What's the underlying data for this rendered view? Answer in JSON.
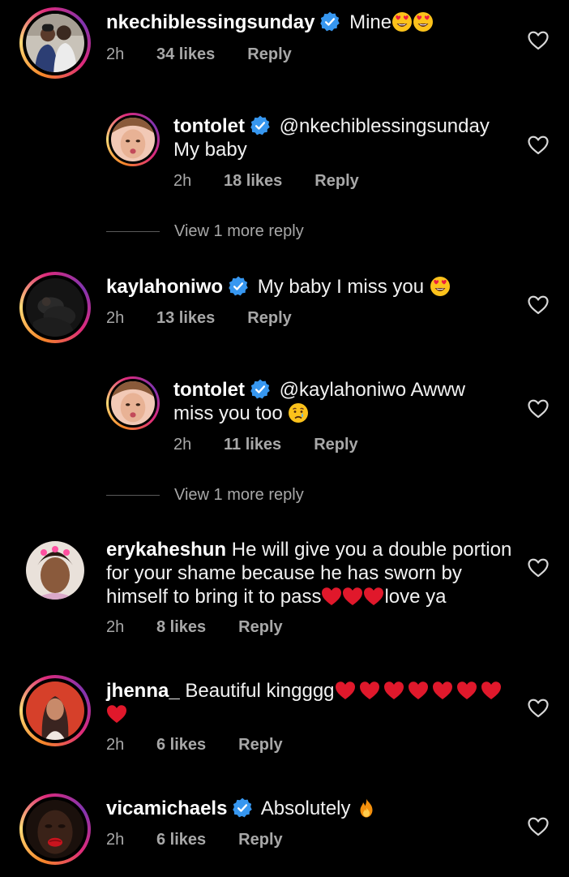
{
  "comments": [
    {
      "username": "nkechiblessingsunday",
      "verified": true,
      "text": "Mine",
      "time": "2h",
      "likes": "34 likes",
      "reply": "Reply"
    },
    {
      "username": "tontolet",
      "verified": true,
      "text_line1": "@nkechiblessingsunday",
      "text_line2": "My baby",
      "time": "2h",
      "likes": "18 likes",
      "reply": "Reply"
    },
    {
      "username": "kaylahoniwo",
      "verified": true,
      "text": "My baby I miss you",
      "time": "2h",
      "likes": "13 likes",
      "reply": "Reply"
    },
    {
      "username": "tontolet",
      "verified": true,
      "text_line1": "@kaylahoniwo Awww",
      "text_line2": "miss you too",
      "time": "2h",
      "likes": "11 likes",
      "reply": "Reply"
    },
    {
      "username": "erykaheshun",
      "verified": false,
      "text_line1": "He will give you a double portion",
      "text_line2": "for your shame because he has sworn by",
      "text_line3": "himself to bring it to pass",
      "text_line3_tail": "love ya",
      "time": "2h",
      "likes": "8 likes",
      "reply": "Reply"
    },
    {
      "username": "jhenna_",
      "verified": false,
      "text": "Beautiful kingggg",
      "time": "2h",
      "likes": "6 likes",
      "reply": "Reply"
    },
    {
      "username": "vicamichaels",
      "verified": true,
      "text": "Absolutely",
      "time": "2h",
      "likes": "6 likes",
      "reply": "Reply"
    }
  ],
  "view_more_1": "View 1 more reply",
  "view_more_2": "View 1 more reply",
  "icons": {
    "like": "heart-outline-icon",
    "verified": "verified-badge-icon"
  },
  "colors": {
    "background": "#000000",
    "verified": "#3797f0",
    "muted": "#a8a8a8"
  }
}
